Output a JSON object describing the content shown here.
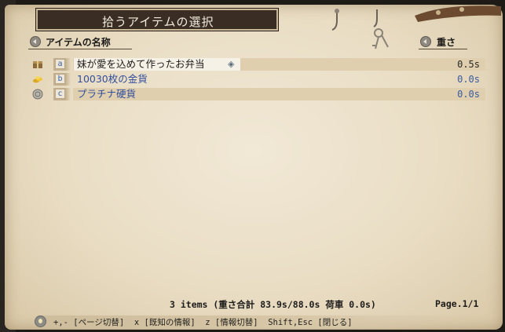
{
  "window": {
    "title": "拾うアイテムの選択"
  },
  "columns": {
    "name": "アイテムの名称",
    "weight": "重さ"
  },
  "items": [
    {
      "key": "a",
      "name": "妹が愛を込めて作ったお弁当",
      "weight": "0.5s",
      "icon": "lunchbox-icon",
      "marked": true
    },
    {
      "key": "b",
      "name": "10030枚の金貨",
      "weight": "0.0s",
      "icon": "gold-coins-icon"
    },
    {
      "key": "c",
      "name": "プラチナ硬貨",
      "weight": "0.0s",
      "icon": "platinum-coin-icon"
    }
  ],
  "status": {
    "summary": "3 items  (重さ合計 83.9s/88.0s  荷車 0.0s)",
    "page": "Page.1/1"
  },
  "help": {
    "text": "+,- [ページ切替]  x [既知の情報]  z [情報切替]  Shift,Esc [閉じる]"
  },
  "colors": {
    "parchment": "#ece2cc",
    "title_plate": "#3a2d24",
    "item_text": "#334e9c",
    "selected_text": "#1e1c1a"
  }
}
